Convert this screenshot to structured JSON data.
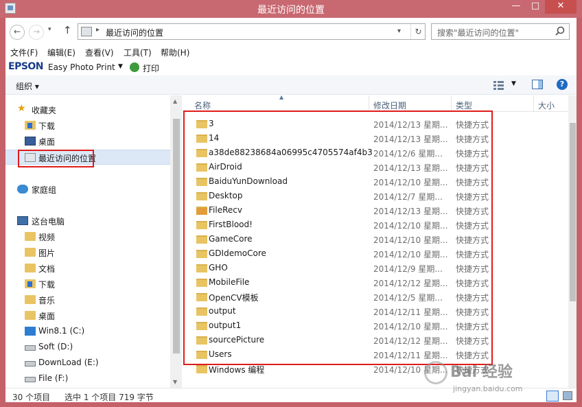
{
  "window": {
    "title": "最近访问的位置",
    "controls": {
      "minimize": "—",
      "maximize": "□",
      "close": "✕"
    }
  },
  "address": {
    "path": "最近访问的位置",
    "search_placeholder": "搜索\"最近访问的位置\""
  },
  "menu": [
    "文件(F)",
    "编辑(E)",
    "查看(V)",
    "工具(T)",
    "帮助(H)"
  ],
  "epson": {
    "brand": "EPSON",
    "product": "Easy Photo Print",
    "print_label": "打印"
  },
  "toolbar": {
    "organize": "组织 ▾"
  },
  "nav": {
    "favorites": {
      "label": "收藏夹",
      "items": [
        "下载",
        "桌面",
        "最近访问的位置"
      ]
    },
    "homegroup": "家庭组",
    "this_pc": {
      "label": "这台电脑",
      "items": [
        "视频",
        "图片",
        "文档",
        "下载",
        "音乐",
        "桌面",
        "Win8.1 (C:)",
        "Soft (D:)",
        "DownLoad (E:)",
        "File (F:)"
      ]
    }
  },
  "columns": {
    "name": "名称",
    "modified": "修改日期",
    "type": "类型",
    "size": "大小"
  },
  "files": [
    {
      "name": "3",
      "date": "2014/12/13 星期...",
      "type": "快捷方式"
    },
    {
      "name": "14",
      "date": "2014/12/13 星期...",
      "type": "快捷方式"
    },
    {
      "name": "a38de88238684a06995c4705574af4b3",
      "date": "2014/12/6 星期...",
      "type": "快捷方式"
    },
    {
      "name": "AirDroid",
      "date": "2014/12/13 星期...",
      "type": "快捷方式"
    },
    {
      "name": "BaiduYunDownload",
      "date": "2014/12/10 星期...",
      "type": "快捷方式"
    },
    {
      "name": "Desktop",
      "date": "2014/12/7 星期...",
      "type": "快捷方式"
    },
    {
      "name": "FileRecv",
      "date": "2014/12/13 星期...",
      "type": "快捷方式"
    },
    {
      "name": "FirstBlood!",
      "date": "2014/12/10 星期...",
      "type": "快捷方式"
    },
    {
      "name": "GameCore",
      "date": "2014/12/10 星期...",
      "type": "快捷方式"
    },
    {
      "name": "GDIdemoCore",
      "date": "2014/12/10 星期...",
      "type": "快捷方式"
    },
    {
      "name": "GHO",
      "date": "2014/12/9 星期...",
      "type": "快捷方式"
    },
    {
      "name": "MobileFile",
      "date": "2014/12/12 星期...",
      "type": "快捷方式"
    },
    {
      "name": "OpenCV模板",
      "date": "2014/12/5 星期...",
      "type": "快捷方式"
    },
    {
      "name": "output",
      "date": "2014/12/11 星期...",
      "type": "快捷方式"
    },
    {
      "name": "output1",
      "date": "2014/12/10 星期...",
      "type": "快捷方式"
    },
    {
      "name": "sourcePicture",
      "date": "2014/12/12 星期...",
      "type": "快捷方式"
    },
    {
      "name": "Users",
      "date": "2014/12/11 星期...",
      "type": "快捷方式"
    },
    {
      "name": "Windows 编程",
      "date": "2014/12/10 星期...",
      "type": "快捷方式"
    }
  ],
  "status": {
    "count": "30 个项目",
    "selection": "选中 1 个项目  719 字节"
  },
  "watermark": {
    "text": "Bai 经验",
    "sub": "jingyan.baidu.com"
  }
}
